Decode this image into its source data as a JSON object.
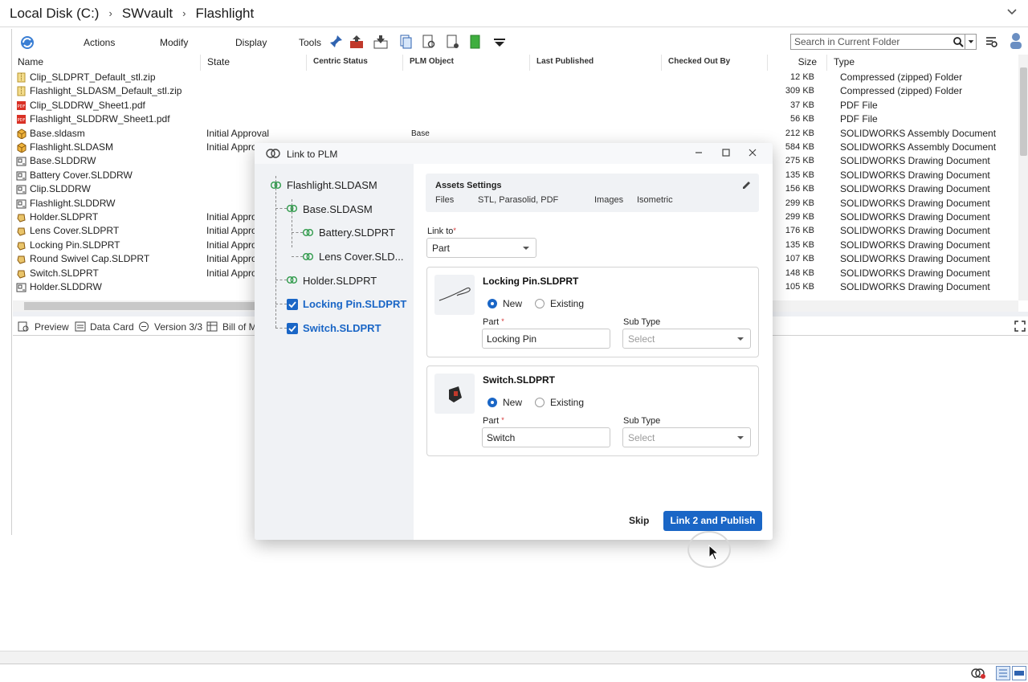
{
  "address": {
    "crumbs": [
      "Local Disk (C:)",
      "SWvault",
      "Flashlight"
    ]
  },
  "toolbar": {
    "menus": [
      "Actions",
      "Modify",
      "Display",
      "Tools"
    ],
    "search_placeholder": "Search in Current Folder"
  },
  "columns": [
    "Name",
    "State",
    "Centric Status",
    "PLM Object",
    "Last Published",
    "Checked Out By",
    "Size",
    "Type"
  ],
  "files": [
    {
      "name": "Clip_SLDPRT_Default_stl.zip",
      "state": "",
      "plm": "",
      "size": "12 KB",
      "type": "Compressed (zipped) Folder",
      "icon": "zip-icon"
    },
    {
      "name": "Flashlight_SLDASM_Default_stl.zip",
      "state": "",
      "plm": "",
      "size": "309 KB",
      "type": "Compressed (zipped) Folder",
      "icon": "zip-icon"
    },
    {
      "name": "Clip_SLDDRW_Sheet1.pdf",
      "state": "",
      "plm": "",
      "size": "37 KB",
      "type": "PDF File",
      "icon": "pdf-icon"
    },
    {
      "name": "Flashlight_SLDDRW_Sheet1.pdf",
      "state": "",
      "plm": "",
      "size": "56 KB",
      "type": "PDF File",
      "icon": "pdf-icon"
    },
    {
      "name": "Base.sldasm",
      "state": "Initial Approval",
      "plm": "Base",
      "size": "212 KB",
      "type": "SOLIDWORKS Assembly Document",
      "icon": "assembly-icon"
    },
    {
      "name": "Flashlight.SLDASM",
      "state": "Initial Appro",
      "plm": "",
      "size": "584 KB",
      "type": "SOLIDWORKS Assembly Document",
      "icon": "assembly-icon"
    },
    {
      "name": "Base.SLDDRW",
      "state": "",
      "plm": "",
      "size": "275 KB",
      "type": "SOLIDWORKS Drawing Document",
      "icon": "drawing-icon"
    },
    {
      "name": "Battery Cover.SLDDRW",
      "state": "",
      "plm": "",
      "size": "135 KB",
      "type": "SOLIDWORKS Drawing Document",
      "icon": "drawing-icon"
    },
    {
      "name": "Clip.SLDDRW",
      "state": "",
      "plm": "",
      "size": "156 KB",
      "type": "SOLIDWORKS Drawing Document",
      "icon": "drawing-icon"
    },
    {
      "name": "Flashlight.SLDDRW",
      "state": "",
      "plm": "",
      "size": "299 KB",
      "type": "SOLIDWORKS Drawing Document",
      "icon": "drawing-icon"
    },
    {
      "name": "Holder.SLDPRT",
      "state": "Initial Approv",
      "plm": "",
      "size": "299 KB",
      "type": "SOLIDWORKS Drawing Document",
      "icon": "part-icon"
    },
    {
      "name": "Lens Cover.SLDPRT",
      "state": "Initial Approv",
      "plm": "",
      "size": "176 KB",
      "type": "SOLIDWORKS Drawing Document",
      "icon": "part-icon"
    },
    {
      "name": "Locking Pin.SLDPRT",
      "state": "Initial Approv",
      "plm": "",
      "size": "135 KB",
      "type": "SOLIDWORKS Drawing Document",
      "icon": "part-icon"
    },
    {
      "name": "Round Swivel Cap.SLDPRT",
      "state": "Initial Approv",
      "plm": "",
      "size": "107 KB",
      "type": "SOLIDWORKS Drawing Document",
      "icon": "part-icon"
    },
    {
      "name": "Switch.SLDPRT",
      "state": "Initial Approv",
      "plm": "",
      "size": "148 KB",
      "type": "SOLIDWORKS Drawing Document",
      "icon": "part-icon"
    },
    {
      "name": "Holder.SLDDRW",
      "state": "",
      "plm": "",
      "size": "105 KB",
      "type": "SOLIDWORKS Drawing Document",
      "icon": "drawing-icon"
    }
  ],
  "bottom_tabs": [
    "Preview",
    "Data Card",
    "Version 3/3",
    "Bill of Ma"
  ],
  "dialog": {
    "title": "Link to PLM",
    "tree": {
      "root": "Flashlight.SLDASM",
      "base": "Base.SLDASM",
      "battery": "Battery.SLDPRT",
      "lens": "Lens Cover.SLD...",
      "holder": "Holder.SLDPRT",
      "locking": "Locking Pin.SLDPRT",
      "switch": "Switch.SLDPRT"
    },
    "assets": {
      "title": "Assets Settings",
      "files_label": "Files",
      "files_value": "STL, Parasolid, PDF",
      "images_label": "Images",
      "images_value": "Isometric"
    },
    "link_to_label": "Link to",
    "link_to_value": "Part",
    "cards": [
      {
        "title": "Locking Pin.SLDPRT",
        "new": "New",
        "existing": "Existing",
        "part_label": "Part",
        "part_value": "Locking Pin",
        "subtype_label": "Sub Type",
        "subtype_placeholder": "Select"
      },
      {
        "title": "Switch.SLDPRT",
        "new": "New",
        "existing": "Existing",
        "part_label": "Part",
        "part_value": "Switch",
        "subtype_label": "Sub Type",
        "subtype_placeholder": "Select"
      }
    ],
    "skip_label": "Skip",
    "publish_label": "Link 2 and Publish"
  },
  "colors": {
    "accent": "#1a66c6",
    "required": "#d32f2f",
    "panel": "#f0f2f5"
  }
}
